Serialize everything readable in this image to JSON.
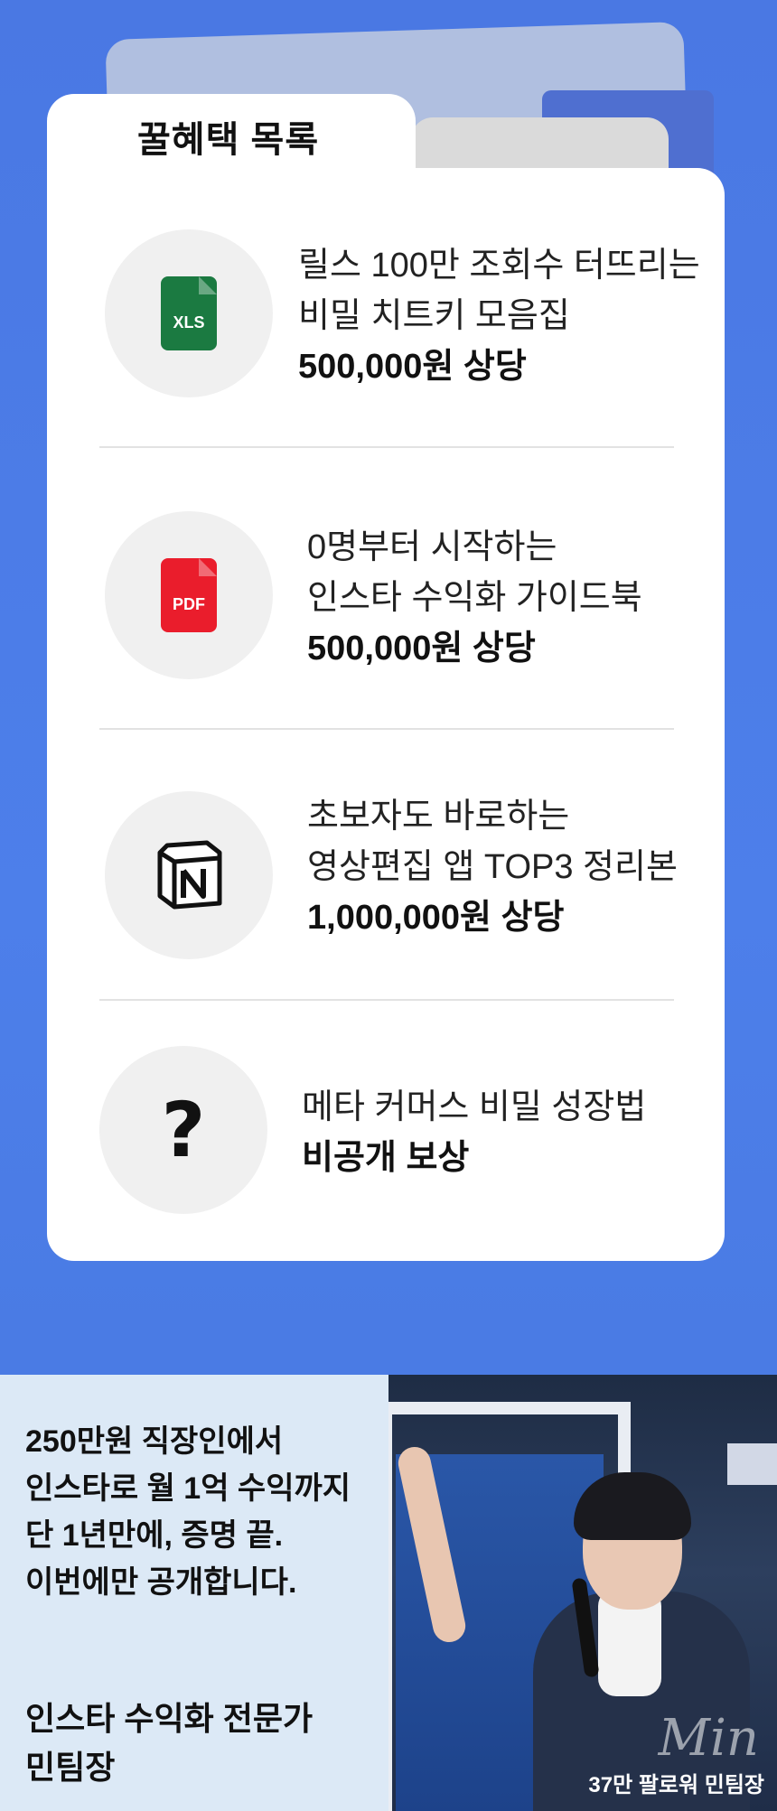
{
  "header": {
    "tab_title": "꿀혜택 목록"
  },
  "benefits": [
    {
      "icon": "xls-file-icon",
      "icon_label": "XLS",
      "icon_color": "#1b7a41",
      "line1": "릴스 100만 조회수 터뜨리는",
      "line2": "비밀 치트키 모음집",
      "value": "500,000원 상당"
    },
    {
      "icon": "pdf-file-icon",
      "icon_label": "PDF",
      "icon_color": "#ea1d2c",
      "line1": "0명부터 시작하는",
      "line2": "인스타 수익화 가이드북",
      "value": "500,000원 상당"
    },
    {
      "icon": "notion-icon",
      "line1": "초보자도 바로하는",
      "line2": "영상편집 앱 TOP3 정리본",
      "value": "1,000,000원 상당"
    },
    {
      "icon": "question-mark-icon",
      "icon_label": "?",
      "line1": "메타 커머스 비밀 성장법",
      "value": "비공개 보상"
    }
  ],
  "profile": {
    "intro_lines": [
      "250만원 직장인에서",
      "인스타로 월 1억 수익까지",
      "단 1년만에, 증명 끝.",
      "이번에만 공개합니다."
    ],
    "role_lines": [
      "인스타 수익화 전문가",
      "민팀장"
    ],
    "signature": "Min",
    "photo_caption": "37만 팔로워 민팀장"
  },
  "colors": {
    "background": "#4a78e3",
    "xls": "#1b7a41",
    "pdf": "#ea1d2c",
    "profile_bg": "#dce9f6"
  }
}
